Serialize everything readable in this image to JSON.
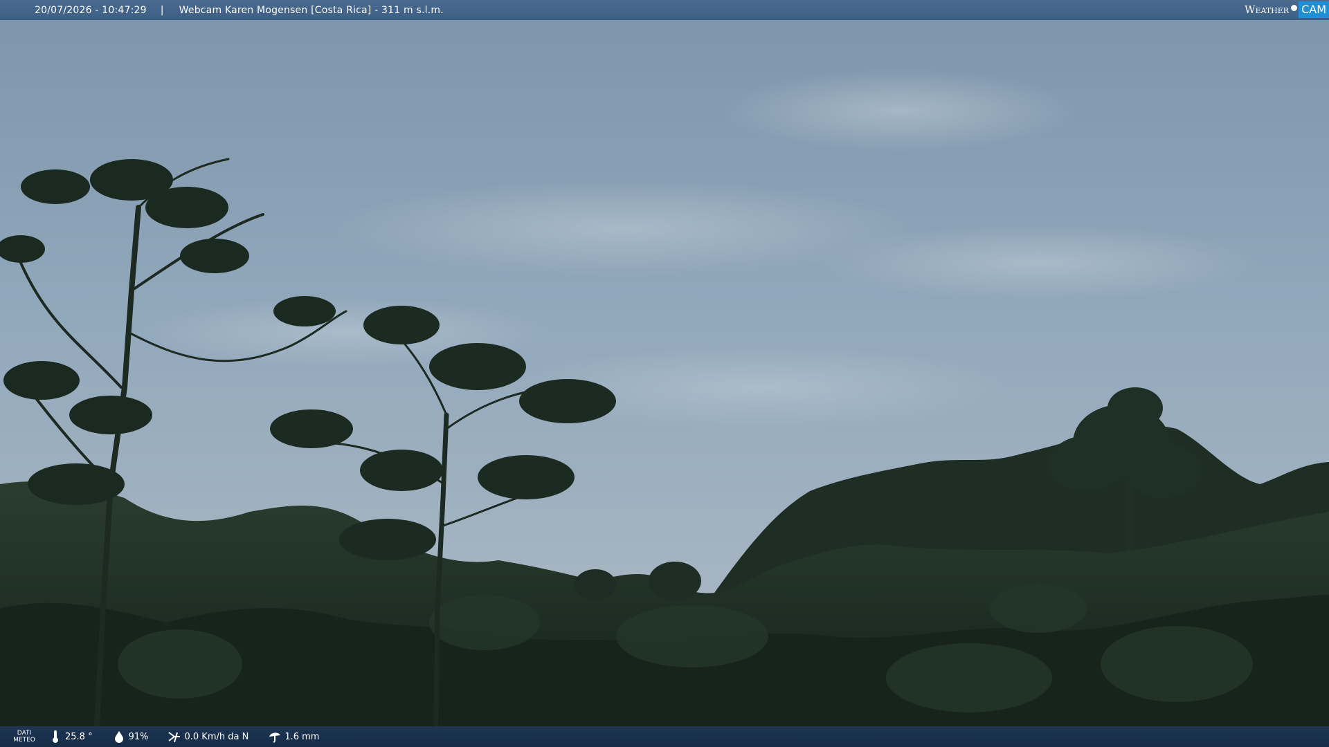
{
  "header": {
    "datetime": "20/07/2026 - 10:47:29",
    "separator": "|",
    "title": "Webcam Karen Mogensen [Costa Rica] - 311 m s.l.m."
  },
  "logo": {
    "weather": "Weather",
    "cam": "CAM"
  },
  "footer": {
    "dati_meteo_line1": "DATI",
    "dati_meteo_line2": "METEO",
    "temperature": "25.8 °",
    "humidity": "91%",
    "wind": "0.0 Km/h da N",
    "rain": "1.6 mm",
    "icons": [
      "thermometer-icon",
      "humidity-icon",
      "wind-icon",
      "rain-icon"
    ]
  },
  "colors": {
    "sky_top": "#7f97ad",
    "sky_mid": "#93aabd",
    "sky_bottom": "#a7b6c3",
    "foliage_dark": "#1b2b22",
    "foliage_mid": "#26392c",
    "topbar": "#3d5f86",
    "bottombar": "#162c47",
    "logo_blue": "#1f8fd6"
  }
}
